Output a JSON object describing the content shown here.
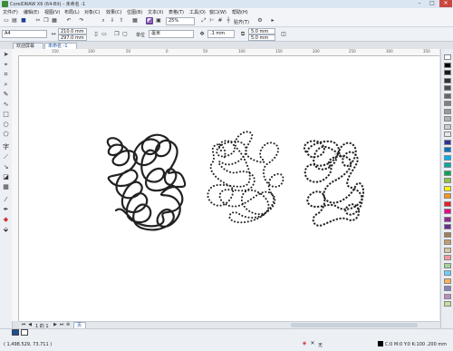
{
  "window": {
    "title": "CorelDRAW X6 (64-Bit) - 未命名 -1",
    "minimize": "–",
    "maximize": "□",
    "close": "✕"
  },
  "menu": [
    "文件(F)",
    "编辑(E)",
    "视图(V)",
    "布局(L)",
    "对象(C)",
    "效果(C)",
    "位图(B)",
    "文本(X)",
    "表格(T)",
    "工具(O)",
    "窗口(W)",
    "帮助(H)"
  ],
  "toolbar": {
    "zoom": "25%",
    "snap_label": "贴齐(T)"
  },
  "propbar": {
    "page_size": "A4",
    "width": "210.0 mm",
    "height": "297.0 mm",
    "unit_label": "单位",
    "unit": "毫米",
    "nudge": ".1 mm",
    "dup_x": "5.0 mm",
    "dup_y": "5.0 mm"
  },
  "tabs": [
    {
      "label": "欢迎屏幕"
    },
    {
      "label": "未命名 -1"
    }
  ],
  "ruler_ticks": [
    "150",
    "100",
    "50",
    "0",
    "50",
    "100",
    "150",
    "200",
    "250",
    "300",
    "350"
  ],
  "page_nav": {
    "page_counter": "1 的 1",
    "page_tab": "页1"
  },
  "status": {
    "coords": "( 1,498.529, 73.711 )",
    "fill_label": "无",
    "outline_info": "C:0 M:0 Y:0 K:100 .200 mm"
  },
  "palette_colors": [
    "#ffffff",
    "#000000",
    "#1a1a1a",
    "#333333",
    "#4d4d4d",
    "#666666",
    "#808080",
    "#999999",
    "#b3b3b3",
    "#cccccc",
    "#e6e6e6",
    "#2e3192",
    "#0072bc",
    "#00aeef",
    "#00a99d",
    "#00a651",
    "#8dc63f",
    "#fff200",
    "#f7941d",
    "#ed1c24",
    "#ec008c",
    "#92278f",
    "#662d91",
    "#a67c52",
    "#c69c6d",
    "#d7c4a3",
    "#f5989d",
    "#a3d39c",
    "#6dcff6",
    "#fbaf5d",
    "#8781bd",
    "#bd8cbf",
    "#c4df9b"
  ],
  "colors": {
    "accent": "#1a4f9c",
    "canvas": "#ffffff",
    "chrome": "#eceff3"
  }
}
